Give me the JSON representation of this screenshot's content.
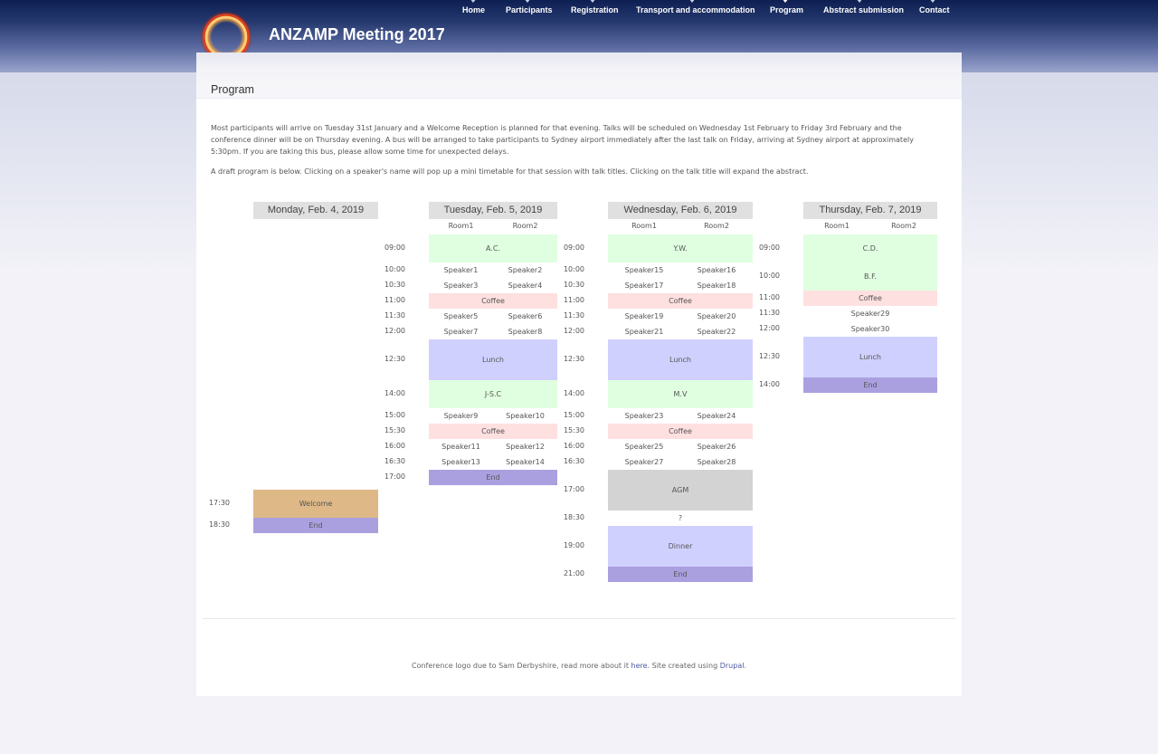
{
  "site": {
    "title": "ANZAMP Meeting 2017"
  },
  "nav": [
    "Home",
    "Participants",
    "Registration",
    "Transport and accommodation",
    "Program",
    "Abstract submission",
    "Contact"
  ],
  "page": {
    "title": "Program",
    "intro1": "Most participants will arrive on Tuesday 31st January and a Welcome Reception is planned for that evening. Talks will be scheduled on Wednesday 1st February to Friday 3rd February and the conference dinner will be on Thursday evening. A bus will be arranged to take participants to Sydney airport immediately after the last talk on Friday, arriving at Sydney airport at approximately 5:30pm. If you are taking this bus, please allow some time for unexpected delays.",
    "intro2": "A draft program is below. Clicking on a speaker's name will pop up a mini timetable for that session with talk titles. Clicking on the talk title will expand the abstract."
  },
  "schedule": {
    "room1": "Room1",
    "room2": "Room2",
    "days": [
      {
        "label": "Monday, Feb. 4, 2019",
        "times": [
          "17:30",
          "18:30"
        ],
        "sessions": [
          "Welcome",
          "End"
        ]
      },
      {
        "label": "Tuesday, Feb. 5, 2019",
        "times": [
          "09:00",
          "10:00",
          "10:30",
          "11:00",
          "11:30",
          "12:00",
          "12:30",
          "14:00",
          "15:00",
          "15:30",
          "16:00",
          "16:30",
          "17:00"
        ],
        "sessions": [
          "A.C.",
          "Speaker1",
          "Speaker2",
          "Speaker3",
          "Speaker4",
          "Coffee",
          "Speaker5",
          "Speaker6",
          "Speaker7",
          "Speaker8",
          "Lunch",
          "J-S.C",
          "Speaker9",
          "Speaker10",
          "Coffee",
          "Speaker11",
          "Speaker12",
          "Speaker13",
          "Speaker14",
          "End"
        ]
      },
      {
        "label": "Wednesday, Feb. 6, 2019",
        "times": [
          "09:00",
          "10:00",
          "10:30",
          "11:00",
          "11:30",
          "12:00",
          "12:30",
          "14:00",
          "15:00",
          "15:30",
          "16:00",
          "16:30",
          "17:00",
          "18:30",
          "19:00",
          "21:00"
        ],
        "sessions": [
          "Y.W.",
          "Speaker15",
          "Speaker16",
          "Speaker17",
          "Speaker18",
          "Coffee",
          "Speaker19",
          "Speaker20",
          "Speaker21",
          "Speaker22",
          "Lunch",
          "M.V",
          "Speaker23",
          "Speaker24",
          "Coffee",
          "Speaker25",
          "Speaker26",
          "Speaker27",
          "Speaker28",
          "AGM",
          "?",
          "Dinner",
          "End"
        ]
      },
      {
        "label": "Thursday, Feb. 7, 2019",
        "times": [
          "09:00",
          "10:00",
          "11:00",
          "11:30",
          "12:00",
          "12:30",
          "14:00"
        ],
        "sessions": [
          "C.D.",
          "B.F.",
          "Coffee",
          "Speaker29",
          "Speaker30",
          "Lunch",
          "End"
        ]
      }
    ]
  },
  "footer": {
    "prefix": "Conference logo due to Sam Derbyshire, read more about it",
    "here_link": "here",
    "middle": ". Site created using",
    "drupal_link": "Drupal",
    "end": "."
  },
  "colors": {
    "talk": "#e0ffe0",
    "coffee": "#ffe0e0",
    "lunch": "#d0d0ff",
    "end": "#aaa0e0",
    "welcome": "#deb887",
    "agm": "#d3d3d3",
    "header": "#0d1f52"
  }
}
